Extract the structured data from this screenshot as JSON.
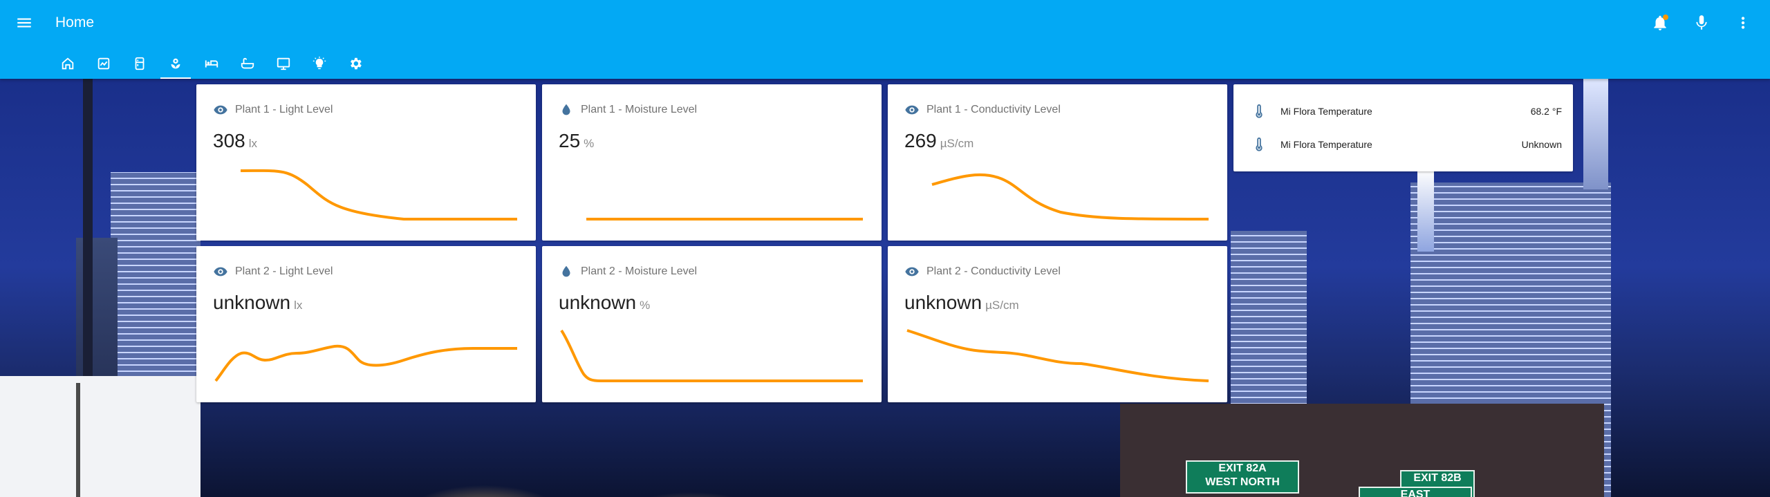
{
  "header": {
    "title": "Home",
    "tabs": [
      {
        "icon": "home-icon"
      },
      {
        "icon": "dashboard-icon"
      },
      {
        "icon": "fridge-icon"
      },
      {
        "icon": "flower-icon",
        "active": true
      },
      {
        "icon": "bed-icon"
      },
      {
        "icon": "bathtub-icon"
      },
      {
        "icon": "monitor-icon"
      },
      {
        "icon": "lightbulb-icon"
      },
      {
        "icon": "settings-icon"
      }
    ],
    "actions": [
      "notifications-icon",
      "microphone-icon",
      "more-vert-icon"
    ]
  },
  "colors": {
    "header": "#03a9f4",
    "icon": "#44739e",
    "graph": "#ff9800",
    "card": "#ffffff"
  },
  "cards": {
    "p1_light": {
      "title": "Plant 1 - Light Level",
      "value": "308",
      "unit": "lx",
      "icon": "eye-icon"
    },
    "p1_moisture": {
      "title": "Plant 1 - Moisture Level",
      "value": "25",
      "unit": "%",
      "icon": "water-drop-icon"
    },
    "p1_conductivity": {
      "title": "Plant 1 - Conductivity Level",
      "value": "269",
      "unit": "µS/cm",
      "icon": "eye-icon"
    },
    "p2_light": {
      "title": "Plant 2 - Light Level",
      "value": "unknown",
      "unit": "lx",
      "icon": "eye-icon"
    },
    "p2_moisture": {
      "title": "Plant 2 - Moisture Level",
      "value": "unknown",
      "unit": "%",
      "icon": "water-drop-icon"
    },
    "p2_conductivity": {
      "title": "Plant 2 - Conductivity Level",
      "value": "unknown",
      "unit": "µS/cm",
      "icon": "eye-icon"
    }
  },
  "entities": [
    {
      "name": "Mi Flora Temperature",
      "value": "68.2 °F",
      "icon": "thermometer-icon"
    },
    {
      "name": "Mi Flora Temperature",
      "value": "Unknown",
      "icon": "thermometer-icon"
    }
  ],
  "background_signs": [
    "EXIT 82A",
    "WEST  NORTH",
    "EXIT 82B",
    "EAST"
  ]
}
